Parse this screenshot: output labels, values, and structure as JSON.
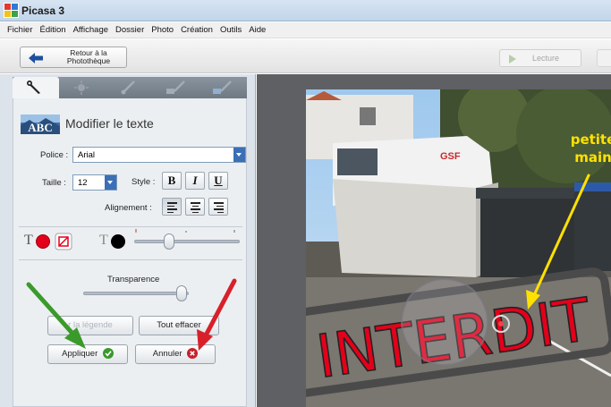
{
  "window": {
    "title": "Picasa 3"
  },
  "menu": [
    "Fichier",
    "Édition",
    "Affichage",
    "Dossier",
    "Photo",
    "Création",
    "Outils",
    "Aide"
  ],
  "toolbar": {
    "back_line1": "Retour à la",
    "back_line2": "Photothèque",
    "play_label": "Lecture"
  },
  "tabs": [
    "wrench-icon",
    "tuning-icon",
    "brush-icon",
    "effects-icon",
    "effects2-icon"
  ],
  "panel": {
    "title": "Modifier le texte",
    "font_label": "Police :",
    "font_value": "Arial",
    "size_label": "Taille :",
    "size_value": "12",
    "style_label": "Style :",
    "bold": "B",
    "italic": "I",
    "underline": "U",
    "align_label": "Alignement :",
    "t_glyph": "T",
    "transparency_label": "Transparence",
    "legend_button": "r la légende",
    "clear_button": "Tout effacer",
    "apply_button": "Appliquer",
    "cancel_button": "Annuler"
  },
  "photo": {
    "stamp_text": "INTERDIT",
    "caption_line1": "petite",
    "caption_line2": "main",
    "van_logo": "GSF"
  },
  "colors": {
    "text_color": "#e4001a",
    "outline_color": "#000000",
    "arrow_green": "#3a9a2a",
    "arrow_red": "#d8202a",
    "arrow_yellow": "#ffe100"
  }
}
